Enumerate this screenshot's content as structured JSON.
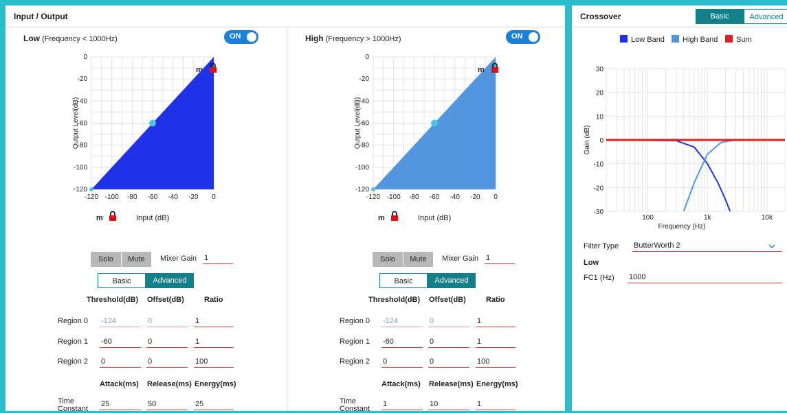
{
  "io": {
    "title": "Input / Output",
    "bands": [
      {
        "name": "Low",
        "range": "(Frequency < 1000Hz)",
        "toggle": "ON",
        "fill_color": "#2032e8",
        "m_label_top": "m",
        "m_label_bottom": "m",
        "y_axis_label": "Output Level(dB)",
        "x_axis_label": "Input (dB)",
        "y_ticks": [
          "0",
          "-20",
          "-40",
          "-60",
          "-80",
          "-100",
          "-120"
        ],
        "x_ticks": [
          "-120",
          "-100",
          "-80",
          "-60",
          "-40",
          "-20",
          "0"
        ],
        "solo": "Solo",
        "mute": "Mute",
        "mixer_gain_label": "Mixer Gain",
        "mixer_gain": "1",
        "mode_basic": "Basic",
        "mode_advanced": "Advanced",
        "col_threshold": "Threshold(dB)",
        "col_offset": "Offset(dB)",
        "col_ratio": "Ratio",
        "regions": [
          {
            "label": "Region 0",
            "threshold": "-124",
            "offset": "0",
            "ratio": "1"
          },
          {
            "label": "Region 1",
            "threshold": "-60",
            "offset": "0",
            "ratio": "1"
          },
          {
            "label": "Region 2",
            "threshold": "0",
            "offset": "0",
            "ratio": "100"
          }
        ],
        "col_attack": "Attack(ms)",
        "col_release": "Release(ms)",
        "col_energy": "Energy(ms)",
        "time_label_1": "Time",
        "time_label_2": "Constant",
        "attack": "25",
        "release": "50",
        "energy": "25"
      },
      {
        "name": "High",
        "range": "(Frequency > 1000Hz)",
        "toggle": "ON",
        "fill_color": "#5396e0",
        "m_label_top": "m",
        "m_label_bottom": "m",
        "y_axis_label": "Output Level(dB)",
        "x_axis_label": "Input (dB)",
        "y_ticks": [
          "0",
          "-20",
          "-40",
          "-60",
          "-80",
          "-100",
          "-120"
        ],
        "x_ticks": [
          "-120",
          "-100",
          "-80",
          "-60",
          "-40",
          "-20",
          "0"
        ],
        "solo": "Solo",
        "mute": "Mute",
        "mixer_gain_label": "Mixer Gain",
        "mixer_gain": "1",
        "mode_basic": "Basic",
        "mode_advanced": "Advanced",
        "col_threshold": "Threshold(dB)",
        "col_offset": "Offset(dB)",
        "col_ratio": "Ratio",
        "regions": [
          {
            "label": "Region 0",
            "threshold": "-124",
            "offset": "0",
            "ratio": "1"
          },
          {
            "label": "Region 1",
            "threshold": "-60",
            "offset": "0",
            "ratio": "1"
          },
          {
            "label": "Region 2",
            "threshold": "0",
            "offset": "0",
            "ratio": "100"
          }
        ],
        "col_attack": "Attack(ms)",
        "col_release": "Release(ms)",
        "col_energy": "Energy(ms)",
        "time_label_1": "Time",
        "time_label_2": "Constant",
        "attack": "1",
        "release": "10",
        "energy": "1"
      }
    ]
  },
  "crossover": {
    "title": "Crossover",
    "tab_basic": "Basic",
    "tab_advanced": "Advanced",
    "legend": [
      {
        "label": "Low Band",
        "color": "#2032e8"
      },
      {
        "label": "High Band",
        "color": "#5396e0"
      },
      {
        "label": "Sum",
        "color": "#e41f1f"
      }
    ],
    "y_axis_label": "Gain (dB)",
    "x_axis_label": "Frequency (Hz)",
    "y_ticks": [
      "30",
      "20",
      "10",
      "0",
      "-10",
      "-20",
      "-30"
    ],
    "x_ticks": [
      "100",
      "1k",
      "10k"
    ],
    "filter_type_label": "Filter Type",
    "filter_type": "ButterWorth 2",
    "section_label": "Low",
    "fc1_label": "FC1 (Hz)",
    "fc1": "1000"
  },
  "chart_data": [
    {
      "type": "area",
      "series": [
        {
          "name": "Low",
          "x": [
            -120,
            -60,
            0
          ],
          "y": [
            -120,
            -60,
            0
          ]
        }
      ],
      "xlabel": "Input (dB)",
      "ylabel": "Output Level(dB)",
      "xlim": [
        -120,
        0
      ],
      "ylim": [
        -120,
        0
      ],
      "marker_point": [
        -60,
        -60
      ],
      "grid": true
    },
    {
      "type": "area",
      "series": [
        {
          "name": "High",
          "x": [
            -120,
            -60,
            0
          ],
          "y": [
            -120,
            -60,
            0
          ]
        }
      ],
      "xlabel": "Input (dB)",
      "ylabel": "Output Level(dB)",
      "xlim": [
        -120,
        0
      ],
      "ylim": [
        -120,
        0
      ],
      "marker_point": [
        -60,
        -60
      ],
      "grid": true
    },
    {
      "type": "line",
      "xscale": "log",
      "xlim": [
        20,
        20000
      ],
      "ylim": [
        -30,
        30
      ],
      "xlabel": "Frequency (Hz)",
      "ylabel": "Gain (dB)",
      "crossover_hz": 1000,
      "filter": "ButterWorth 2",
      "series": [
        {
          "name": "Low Band",
          "x": [
            20,
            300,
            600,
            1000,
            1500,
            2000,
            2400
          ],
          "y": [
            0,
            -0.3,
            -3,
            -10,
            -18,
            -25,
            -30
          ]
        },
        {
          "name": "High Band",
          "x": [
            400,
            600,
            1000,
            1700,
            3000,
            20000
          ],
          "y": [
            -30,
            -18,
            -6,
            -1,
            0,
            0
          ]
        },
        {
          "name": "Sum",
          "x": [
            20,
            20000
          ],
          "y": [
            0,
            0
          ]
        }
      ],
      "grid": true
    }
  ]
}
